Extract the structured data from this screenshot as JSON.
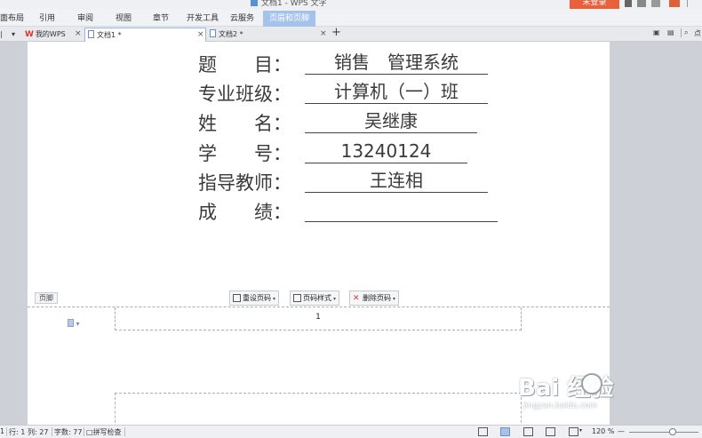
{
  "window": {
    "title": "文档1 - WPS 文字",
    "login_button": "未登录"
  },
  "ribbon": {
    "tabs": [
      {
        "label": "面布局"
      },
      {
        "label": "引用"
      },
      {
        "label": "审阅"
      },
      {
        "label": "视图"
      },
      {
        "label": "章节"
      },
      {
        "label": "开发工具"
      },
      {
        "label": "云服务"
      },
      {
        "label": "页眉和页脚",
        "active": true
      }
    ]
  },
  "doc_tabs": {
    "items": [
      {
        "label": "我的WPS",
        "icon": "wps-logo-icon"
      },
      {
        "label": "文档1 *",
        "icon": "document-icon",
        "active": true
      },
      {
        "label": "文档2 *",
        "icon": "document-icon"
      }
    ],
    "right_label": "点"
  },
  "cover": {
    "fields": [
      {
        "label": "题　　目：",
        "value": "销售　管理系统"
      },
      {
        "label": "专业班级：",
        "value": "计算机（一）班"
      },
      {
        "label": "姓　　名：",
        "value": "吴继康"
      },
      {
        "label": "学　　号：",
        "value": "13240124"
      },
      {
        "label": "指导教师：",
        "value": "王连相"
      },
      {
        "label": "成　　绩：",
        "value": ""
      }
    ]
  },
  "footer_tools": {
    "section_label": "页脚",
    "buttons": [
      {
        "label": "重设页码",
        "icon": "reset-page-number-icon"
      },
      {
        "label": "页码样式",
        "icon": "page-number-style-icon"
      },
      {
        "label": "删除页码",
        "icon": "delete-icon"
      }
    ],
    "page_number": "1"
  },
  "watermark": {
    "brand": "Bai 经验",
    "url": "jingyan.baidu.com"
  },
  "status": {
    "page": "1",
    "row": "行: 1",
    "column": "列: 27",
    "word_count": "字数: 77",
    "spell_check": "拼写检查",
    "zoom": "120 %",
    "zoom_minus": "—"
  }
}
